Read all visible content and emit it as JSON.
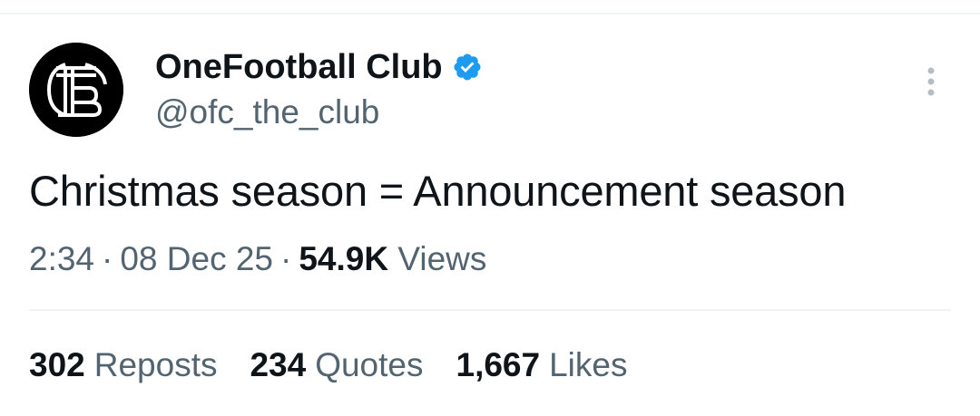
{
  "tweet": {
    "author": {
      "display_name": "OneFootball Club",
      "handle": "@ofc_the_club",
      "verified": true,
      "avatar_icon": "ofc-monogram-logo"
    },
    "text": "Christmas season = Announcement season",
    "meta": {
      "time": "2:34",
      "separator": "·",
      "date": "08 Dec 25",
      "views_count": "54.9K",
      "views_label": "Views"
    },
    "stats": [
      {
        "count": "302",
        "label": "Reposts"
      },
      {
        "count": "234",
        "label": "Quotes"
      },
      {
        "count": "1,667",
        "label": "Likes"
      }
    ]
  },
  "colors": {
    "text_primary": "#0f1419",
    "text_secondary": "#536471",
    "verified_blue": "#1d9bf0",
    "divider": "#eff3f4"
  },
  "icons": {
    "verified": "verified-badge-icon",
    "more": "more-vertical-icon"
  }
}
